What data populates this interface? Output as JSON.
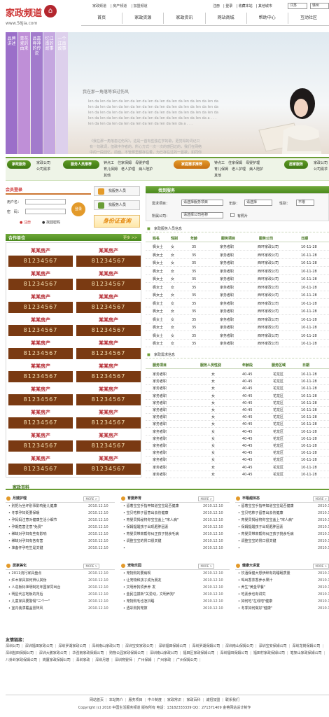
{
  "header": {
    "logo_text": "家政频道",
    "site": "www.58jia.com",
    "top_links": [
      "家政频道",
      "房产频道",
      "加盟频道"
    ],
    "user_links": [
      "注册",
      "登录",
      "收藏本站",
      "其他城市"
    ],
    "city": "江苏",
    "city2": "徐州",
    "nav": [
      "首页",
      "家政资源",
      "家政资讯",
      "网站商城",
      "帮助中心",
      "互动社区"
    ]
  },
  "banner": {
    "tabs": [
      "品牌讲述",
      "青花瓷的由来",
      "品嘉尊神的传说",
      "忆江南的故事",
      "一个江南故事"
    ],
    "tab_colors": [
      "#9b6fc9",
      "#bf8fd7",
      "#a27bcc",
      "#c5a7e0",
      "#ddd0ec"
    ],
    "title": "我在那一角落等谁过伤风",
    "lines": "len da len da len da len da len da len da len da len da len da len da len da len da len da len da len da len da len da len da len da len da len da len da len da len da len da len da len da len da len da len da len da len da len da len da len da len da len da len da len da len da len da len da len da a . . . len da len da len da len da len da len da len da len da a . . .",
    "quote": "《我在那一角落患过伤风》，这是一首有些独在学的歌，更觉得的词记只有一句歌词，但歌中作者的。所心方式一次一次的感回过的，我们在网络中的一段回忆，前面。不管那里都存在着，为已存在过的一首歌，如同你一路大量乐的过。《我在那一角落患过伤风》，这一首在《乌聊城播，不断回复》后结构",
    "numbers": "12345"
  },
  "services": {
    "badges": [
      "家政服务",
      "服务人员推荐",
      "家庭需求推荐",
      "居家服务"
    ],
    "group1": [
      [
        "家政公司",
        "公司需求"
      ]
    ],
    "group2": [
      [
        "钟点工",
        "住家保姆",
        "母婴护理"
      ],
      [
        "育儿保姆",
        "老人护理",
        "病人陪护"
      ],
      [
        "其他"
      ]
    ],
    "group3": [
      [
        "钟点工",
        "住家保姆",
        "母婴护理"
      ],
      [
        "育儿保姆",
        "老人护理",
        "病人陪护"
      ],
      [
        "其他"
      ]
    ],
    "group4": [
      [
        "家政公司",
        "公司需求"
      ]
    ]
  },
  "login": {
    "title": "会员登录",
    "user_label": "用户名：",
    "pass_label": "密　码：",
    "login_btn": "登录",
    "register": "注册",
    "find_pass": "找回密码"
  },
  "side": {
    "find_staff": "找服务人员",
    "find_job": "找服务人员",
    "id_query": "身份证查询"
  },
  "partner": {
    "title": "合作单位",
    "more": "更多 >>",
    "brand": "某某房产",
    "phone": "81234567",
    "count": 20
  },
  "search": {
    "title": "找到服务",
    "req_label": "需求项目：",
    "req_value": "请选择服务项目",
    "age_label": "年龄：",
    "age_value": "请选择",
    "gender_label": "性别：",
    "gender_value": "不限",
    "company_label": "所属公司：",
    "company_value": "请选择公司名称",
    "photo_label": "有照片"
  },
  "staff": {
    "title": "家政服务人员信息",
    "cols": [
      "姓名",
      "性别",
      "年龄",
      "服务项目",
      "服务公司",
      "日期"
    ],
    "rows": [
      [
        "枫女士",
        "女",
        "35",
        "家务者职",
        "西环家政公司",
        "10-11-28"
      ],
      [
        "枫女士",
        "女",
        "35",
        "家务者职",
        "西环家政公司",
        "10-11-28"
      ],
      [
        "枫女士",
        "女",
        "35",
        "家务者职",
        "西环家政公司",
        "10-11-28"
      ],
      [
        "枫女士",
        "女",
        "35",
        "家务者职",
        "西环家政公司",
        "10-11-28"
      ],
      [
        "枫女士",
        "女",
        "35",
        "家务者职",
        "西环家政公司",
        "10-11-28"
      ],
      [
        "枫女士",
        "女",
        "35",
        "家务者职",
        "西环家政公司",
        "10-11-28"
      ],
      [
        "枫女士",
        "女",
        "35",
        "家务者职",
        "西环家政公司",
        "10-11-28"
      ],
      [
        "枫女士",
        "女",
        "35",
        "家务者职",
        "西环家政公司",
        "10-11-28"
      ],
      [
        "枫女士",
        "女",
        "35",
        "家务者职",
        "西环家政公司",
        "10-11-28"
      ],
      [
        "枫女士",
        "女",
        "35",
        "家务者职",
        "西环家政公司",
        "10-11-28"
      ],
      [
        "枫女士",
        "女",
        "35",
        "家务者职",
        "西环家政公司",
        "10-11-28"
      ],
      [
        "枫女士",
        "女",
        "35",
        "家务者职",
        "西环家政公司",
        "10-11-28"
      ],
      [
        "枫女士",
        "女",
        "35",
        "家务者职",
        "西环家政公司",
        "10-11-28"
      ]
    ]
  },
  "demand": {
    "title": "家政需求信息",
    "cols": [
      "服务项目",
      "服务人员性别",
      "年龄段",
      "服务区域",
      "日期"
    ],
    "rows": [
      [
        "家务者职",
        "女",
        "40-45",
        "花龙区",
        "10-11-28"
      ],
      [
        "家务者职",
        "女",
        "40-45",
        "花龙区",
        "10-11-28"
      ],
      [
        "家务者职",
        "女",
        "40-45",
        "花龙区",
        "10-11-28"
      ],
      [
        "家务者职",
        "女",
        "40-45",
        "花龙区",
        "10-11-28"
      ],
      [
        "家务者职",
        "女",
        "40-45",
        "花龙区",
        "10-11-28"
      ],
      [
        "家务者职",
        "女",
        "40-45",
        "花龙区",
        "10-11-28"
      ],
      [
        "家务者职",
        "女",
        "40-45",
        "花龙区",
        "10-11-28"
      ],
      [
        "家务者职",
        "女",
        "40-45",
        "花龙区",
        "10-11-28"
      ],
      [
        "家务者职",
        "女",
        "40-45",
        "花龙区",
        "10-11-28"
      ],
      [
        "家务者职",
        "女",
        "40-45",
        "花龙区",
        "10-11-28"
      ],
      [
        "家务者职",
        "女",
        "40-45",
        "花龙区",
        "10-11-28"
      ],
      [
        "家务者职",
        "女",
        "40-45",
        "花龙区",
        "10-11-28"
      ],
      [
        "家务者职",
        "女",
        "40-45",
        "花龙区",
        "10-11-28"
      ],
      [
        "家务者职",
        "女",
        "40-45",
        "花龙区",
        "10-11-28"
      ],
      [
        "家务者职",
        "女",
        "40-45",
        "花龙区",
        "10-11-28"
      ]
    ]
  },
  "encyclopedia": {
    "title": "家政百科",
    "more": "MORE >",
    "panels": [
      {
        "name": "月嫂护理",
        "items": [
          [
            "别把为坐坏别事影响胎儿健康",
            "2010.12.10"
          ],
          [
            "冬季孕妇贬要保暖",
            "2010.12.10"
          ],
          [
            "孕妈妈注意对健康生活小细节",
            "2010.12.10"
          ],
          [
            "孕期危害注意\"免费\"",
            "2010.12.10"
          ],
          [
            "稀缺对孕妇有些有影响",
            "2010.12.10"
          ],
          [
            "稀缺对孕妇有各有害",
            "2010.12.10"
          ],
          [
            "准备怀孕吃生是关键",
            "2010.12.10"
          ]
        ]
      },
      {
        "name": "育婴养育",
        "items": [
          [
            "留着宝宝手指甲知道宝宝是否健康",
            "2010.12.10"
          ],
          [
            "宝贝吃柿子留意出去伤健康",
            "2010.12.10"
          ],
          [
            "育婴员揭秘将你宝宝盖上\"宋人病\"",
            "2010.12.10"
          ],
          [
            "保姆提醒孩子出现肥胖因素",
            "2010.12.10"
          ],
          [
            "育婴员带来帮你纠正孩子挑食毛病",
            "2010.12.10"
          ],
          [
            "调整宝宝的胃口很关键",
            "2010.12.10"
          ],
          [
            "",
            "2010.12.10"
          ]
        ]
      },
      {
        "name": "丰眠越体态",
        "items": [
          [
            "留着宝宝手指甲知道宝宝是否健康",
            "2010.12.10"
          ],
          [
            "宝贝吃柿子留意出去伤健康",
            "2010.12.10"
          ],
          [
            "育婴员揭秘将你宝宝盖上\"宋人病\"",
            "2010.12.10"
          ],
          [
            "保姆提醒孩子出现肥胖因素",
            "2010.12.10"
          ],
          [
            "育婴员带来帮你纠正孩子挑食毛病",
            "2010.12.10"
          ],
          [
            "调整宝宝的胃口很关键",
            "2010.12.10"
          ],
          [
            "",
            "2010.12.10"
          ]
        ]
      },
      {
        "name": "居家美化",
        "items": [
          [
            "2011流行家具盘点",
            "2010.12.10"
          ],
          [
            "红木家具如何辨认其伪",
            "2010.12.10"
          ],
          [
            "人造板标准明制定年国家同出台",
            "2010.12.10"
          ],
          [
            "明星代言地板的背后",
            "2010.12.10"
          ],
          [
            "儿童家具要警惕\"三个一\"",
            "2010.12.10"
          ],
          [
            "室内装潢覆盖雷阵风",
            "2010.12.10"
          ]
        ]
      },
      {
        "name": "宠物乐园",
        "items": [
          [
            "宠物狗的要病现",
            "2010.12.10"
          ],
          [
            "让宠物和孩子成为朋友",
            "2010.12.10"
          ],
          [
            "文明养狗须养养 发",
            "2010.12.10"
          ],
          [
            "金民拉摸新\"关爱动，文明养狗\"",
            "2010.12.10"
          ],
          [
            "宠物狗毛也怎抖睡",
            "2010.12.10"
          ],
          [
            "透彩狗狗宠擦",
            "2010.12.10"
          ]
        ]
      },
      {
        "name": "健康大讲堂",
        "items": [
          [
            "饮酒保健大怒伊醉有的睡眠质量",
            "2010.12.10"
          ],
          [
            "喝出香茶香养水果汁",
            "2010.12.10"
          ],
          [
            "养生\"黄金早餐\"",
            "2010.12.10"
          ],
          [
            "吃素食也有讲究",
            "2010.12.10"
          ],
          [
            "如何吃\"在线吧\"健康",
            "2010.12.10"
          ],
          [
            "冬季如何做好\"健康\"",
            "2010.12.10"
          ]
        ]
      }
    ]
  },
  "links": {
    "title": "友情链接：",
    "items": [
      "深圳公司",
      "深圳福田家政公司",
      "深圳罗湖家政公司",
      "深圳南山家政公司",
      "深圳宝安家政公司",
      "深圳福田保姆公司",
      "深圳罗湖保姆公司",
      "深圳南山保姆公司",
      "深圳宝安保姆公司",
      "深圳龙岗保姆公司",
      "深圳盐田保姆公司",
      "深圳大鹏家政公司",
      "华强南家政保姆公司",
      "购物公园家政保姆公司",
      "深圳南山家政公司",
      "福田区家政保姆公司",
      "深圳福田保姆公司",
      "福田村家政保姆公司",
      "笔架山家政保姆公司",
      "八卦岭家政保姆公司",
      "岗厦家政保姆公司",
      "深圳家政",
      "深圳月嫂",
      "深圳育婴师",
      "广州保姆",
      "广州家政",
      "广州保姆公司"
    ]
  },
  "footer": {
    "links": [
      "网站首页",
      "本站简介",
      "服务项目",
      "中介制度",
      "家政常识",
      "家政百科",
      "诚招加盟",
      "联系我们"
    ],
    "copyright": "Copyright (c) 2010  中国生活服务频道  版权所有  电话：13182333339  QQ：271371409  金艳网站设计制作"
  }
}
